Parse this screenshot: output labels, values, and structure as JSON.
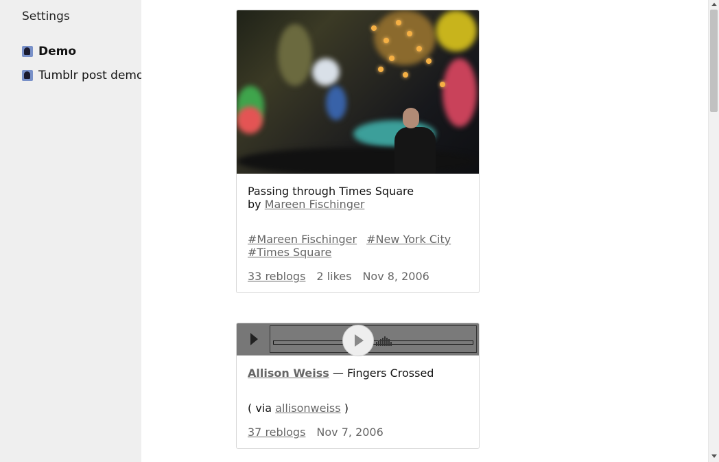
{
  "sidebar": {
    "settings_label": "Settings",
    "blogs": [
      {
        "label": "Demo",
        "icon": "avatar-icon",
        "active": true
      },
      {
        "label": "Tumblr post demo",
        "icon": "avatar-icon",
        "active": false
      }
    ]
  },
  "posts": [
    {
      "type": "photo",
      "caption_title": "Passing through Times Square",
      "caption_by_prefix": "by",
      "caption_author": "Mareen Fischinger",
      "tags": [
        "#Mareen Fischinger",
        "#New York City",
        "#Times Square"
      ],
      "reblogs": "33 reblogs",
      "likes": "2 likes",
      "date": "Nov 8, 2006"
    },
    {
      "type": "audio",
      "artist": "Allison Weiss",
      "dash": "—",
      "track": "Fingers Crossed",
      "via_prefix": "( via",
      "via_source": "allisonweiss",
      "via_suffix": ")",
      "reblogs": "37 reblogs",
      "date": "Nov 7, 2006"
    }
  ]
}
